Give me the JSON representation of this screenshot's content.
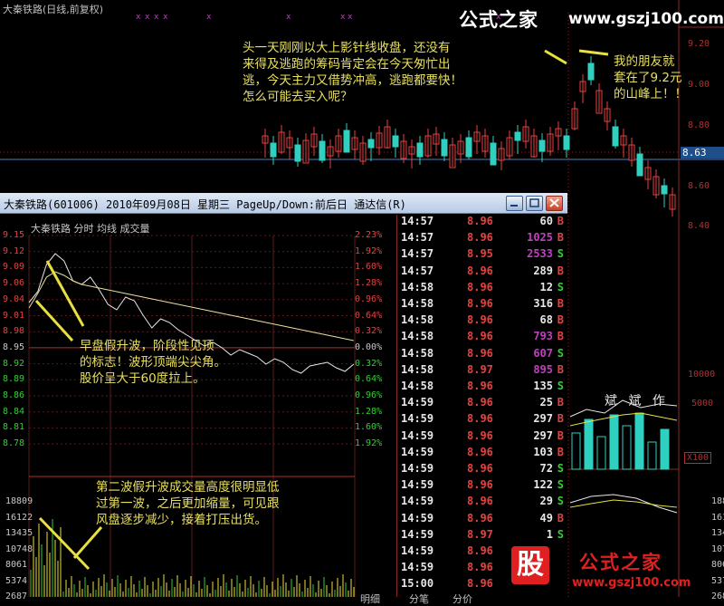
{
  "daily": {
    "title": "大秦铁路(日线,前复权)",
    "price_tag": "8.63",
    "right_axis": [
      "9.20",
      "9.00",
      "8.80",
      "8.60",
      "8.40"
    ],
    "volume_axis": [
      "10000",
      "5000"
    ],
    "x100": "X100",
    "indicator_title": "斌  斌  作"
  },
  "watermark": {
    "brand": "公式之家",
    "url": "www.gszj100.com",
    "logo_char": "股",
    "logo_name": "公式之家",
    "logo_url": "www.gszj100.com"
  },
  "annotations": {
    "top_lines": [
      "头一天刚刚以大上影针线收盘，还没有",
      "来得及逃跑的筹码肯定会在今天匆忙出",
      "逃，今天主力又借势冲高，逃跑都要快！",
      "怎么可能去买入呢？"
    ],
    "right_lines": [
      "我的朋友就",
      "套在了9.2元",
      "的山峰上！！"
    ],
    "mid_lines": [
      "早盘假升波，阶段性见顶",
      "的标志！波形顶端尖尖角。",
      "股价呈大于60度拉上。"
    ],
    "bottom_lines": [
      "第二波假升波成交量高度很明显低",
      "过第一波，之后更加缩量，可见跟",
      "风盘逐步减少，接着打压出货。"
    ]
  },
  "intraday": {
    "window_title": "大秦铁路(601006) 2010年09月08日 星期三 PageUp/Down:前后日 通达信(R)",
    "sub_title": "大秦铁路   分时  均线  成交量",
    "price_axis": [
      "9.15",
      "9.12",
      "9.09",
      "9.06",
      "9.04",
      "9.01",
      "8.98",
      "8.95",
      "8.92",
      "8.89",
      "8.86",
      "8.84",
      "8.81",
      "8.78"
    ],
    "pct_axis": [
      "2.23%",
      "1.92%",
      "1.60%",
      "1.28%",
      "0.96%",
      "0.64%",
      "0.32%",
      "0.00%",
      "0.32%",
      "0.64%",
      "0.96%",
      "1.28%",
      "1.60%",
      "1.92%"
    ],
    "vol_axis": [
      "18809",
      "16122",
      "13435",
      "10748",
      "8061",
      "5374",
      "2687"
    ],
    "ticks": [
      {
        "time": "14:57",
        "price": "8.96",
        "vol": "60",
        "side": "B",
        "vol_color": "#e6e6e6"
      },
      {
        "time": "14:57",
        "price": "8.96",
        "vol": "1025",
        "side": "B",
        "vol_color": "#c040c0"
      },
      {
        "time": "14:57",
        "price": "8.95",
        "vol": "2533",
        "side": "S",
        "vol_color": "#c040c0"
      },
      {
        "time": "14:57",
        "price": "8.96",
        "vol": "289",
        "side": "B",
        "vol_color": "#e6e6e6"
      },
      {
        "time": "14:58",
        "price": "8.96",
        "vol": "12",
        "side": "S",
        "vol_color": "#e6e6e6"
      },
      {
        "time": "14:58",
        "price": "8.96",
        "vol": "316",
        "side": "B",
        "vol_color": "#e6e6e6"
      },
      {
        "time": "14:58",
        "price": "8.96",
        "vol": "68",
        "side": "B",
        "vol_color": "#e6e6e6"
      },
      {
        "time": "14:58",
        "price": "8.96",
        "vol": "793",
        "side": "B",
        "vol_color": "#c040c0"
      },
      {
        "time": "14:58",
        "price": "8.96",
        "vol": "607",
        "side": "S",
        "vol_color": "#c040c0"
      },
      {
        "time": "14:58",
        "price": "8.97",
        "vol": "895",
        "side": "B",
        "vol_color": "#c040c0"
      },
      {
        "time": "14:58",
        "price": "8.96",
        "vol": "135",
        "side": "S",
        "vol_color": "#e6e6e6"
      },
      {
        "time": "14:59",
        "price": "8.96",
        "vol": "25",
        "side": "B",
        "vol_color": "#e6e6e6"
      },
      {
        "time": "14:59",
        "price": "8.96",
        "vol": "297",
        "side": "B",
        "vol_color": "#e6e6e6"
      },
      {
        "time": "14:59",
        "price": "8.96",
        "vol": "297",
        "side": "B",
        "vol_color": "#e6e6e6"
      },
      {
        "time": "14:59",
        "price": "8.96",
        "vol": "103",
        "side": "B",
        "vol_color": "#e6e6e6"
      },
      {
        "time": "14:59",
        "price": "8.96",
        "vol": "72",
        "side": "S",
        "vol_color": "#e6e6e6"
      },
      {
        "time": "14:59",
        "price": "8.96",
        "vol": "122",
        "side": "S",
        "vol_color": "#e6e6e6"
      },
      {
        "time": "14:59",
        "price": "8.96",
        "vol": "29",
        "side": "S",
        "vol_color": "#e6e6e6"
      },
      {
        "time": "14:59",
        "price": "8.96",
        "vol": "49",
        "side": "B",
        "vol_color": "#e6e6e6"
      },
      {
        "time": "14:59",
        "price": "8.97",
        "vol": "1",
        "side": "S",
        "vol_color": "#e6e6e6"
      },
      {
        "time": "14:59",
        "price": "8.96",
        "vol": "",
        "side": "",
        "vol_color": "#e6e6e6"
      },
      {
        "time": "14:59",
        "price": "8.96",
        "vol": "",
        "side": "",
        "vol_color": "#e6e6e6"
      },
      {
        "time": "15:00",
        "price": "8.96",
        "vol": "",
        "side": "",
        "vol_color": "#e6e6e6"
      }
    ],
    "bottom_tabs": [
      "明细",
      "分笔",
      "分价"
    ]
  },
  "colors": {
    "up": "#e84040",
    "down": "#30d0c0",
    "buy": "#e84040",
    "sell": "#30d030"
  }
}
